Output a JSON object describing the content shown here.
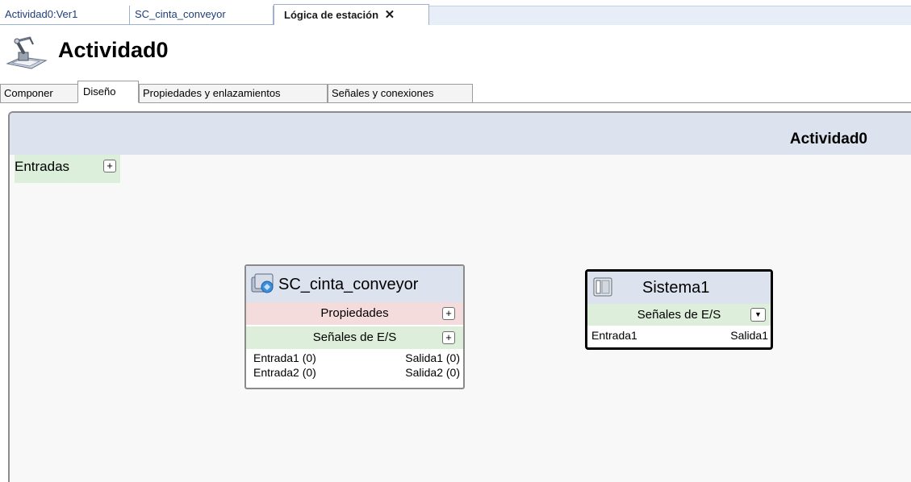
{
  "doc_tabs": [
    {
      "label": "Actividad0:Ver1"
    },
    {
      "label": "SC_cinta_conveyor"
    },
    {
      "label": "Lógica de estación",
      "close": "✕"
    }
  ],
  "header": {
    "title": "Actividad0"
  },
  "view_tabs": [
    {
      "label": "Componer"
    },
    {
      "label": "Diseño"
    },
    {
      "label": "Propiedades y enlazamientos"
    },
    {
      "label": "Señales y conexiones"
    }
  ],
  "canvas": {
    "title": "Actividad0",
    "inputs_label": "Entradas",
    "plus": "+",
    "components": [
      {
        "name": "SC_cinta_conveyor",
        "properties_label": "Propiedades",
        "signals_label": "Señales de E/S",
        "inputs": [
          "Entrada1 (0)",
          "Entrada2 (0)"
        ],
        "outputs": [
          "Salida1 (0)",
          "Salida2 (0)"
        ]
      },
      {
        "name": "Sistema1",
        "signals_label": "Señales de E/S",
        "dropdown": "▼",
        "inputs": [
          "Entrada1"
        ],
        "outputs": [
          "Salida1"
        ]
      }
    ]
  }
}
